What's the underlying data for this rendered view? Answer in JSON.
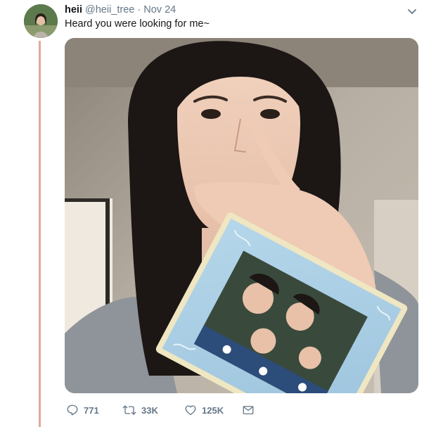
{
  "tweet": {
    "author_name": "heii",
    "author_handle": "@heii_tree",
    "separator": "·",
    "date": "Nov 24",
    "text": "Heard you were looking for me~",
    "media_description_icon": "photo",
    "actions": {
      "replies": "771",
      "retweets": "33K",
      "likes": "125K"
    },
    "icons": [
      "chevron-down-icon",
      "reply-icon",
      "retweet-icon",
      "like-icon",
      "message-icon"
    ]
  },
  "colors": {
    "thread_line": "#e0a9a0",
    "secondary_text": "#657786",
    "primary_text": "#14171a",
    "frame_blue": "#a9cde4"
  }
}
